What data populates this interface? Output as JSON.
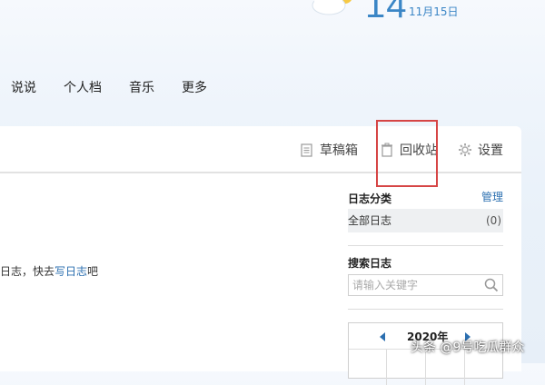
{
  "weather": {
    "day": "14",
    "date": "11月15日"
  },
  "nav": {
    "items": [
      "说说",
      "个人档",
      "音乐",
      "更多"
    ]
  },
  "toolbar": {
    "draft": "草稿箱",
    "recycle": "回收站",
    "settings": "设置"
  },
  "main": {
    "message_prefix": "日志，快去",
    "message_link": "写日志",
    "message_suffix": "吧"
  },
  "sidebar": {
    "category_title": "日志分类",
    "manage": "管理",
    "all_label": "全部日志",
    "all_count": "(0)",
    "search_title": "搜索日志",
    "search_placeholder": "请输入关键字"
  },
  "calendar": {
    "year": "2020年"
  },
  "watermark": "头条 @9号吃瓜群众",
  "colors": {
    "accent": "#2b6fb0",
    "highlight": "#d64545",
    "weather_text": "#3b86c6"
  }
}
